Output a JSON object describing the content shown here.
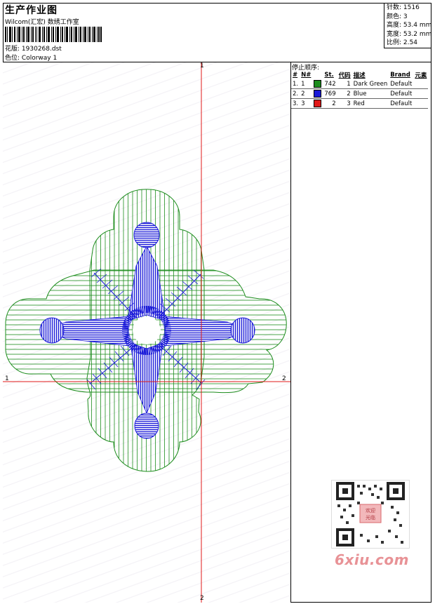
{
  "header": {
    "title": "生产作业图",
    "studio": "Wilcom(汇宏) 数绣工作室",
    "file_label": "花版:",
    "file_value": "1930268.dst",
    "colorway_label": "色位:",
    "colorway_value": "Colorway 1"
  },
  "specs": {
    "stitches_label": "针数:",
    "stitches_value": "1516",
    "colors_label": "颜色:",
    "colors_value": "3",
    "height_label": "高度:",
    "height_value": "53.4 mm",
    "width_label": "宽度:",
    "width_value": "53.2 mm",
    "ratio_label": "比例:",
    "ratio_value": "2.54"
  },
  "stop_sequence": {
    "title": "停止顺序:",
    "columns": [
      "#",
      "N#",
      "St.",
      "代码",
      "描述",
      "Brand",
      "元素"
    ],
    "rows": [
      {
        "idx": "1.",
        "needle": "1",
        "color": "#1c8c1c",
        "stitches": "742",
        "code": "1",
        "desc": "Dark Green",
        "brand": "Default"
      },
      {
        "idx": "2.",
        "needle": "2",
        "color": "#1a1ad8",
        "stitches": "769",
        "code": "2",
        "desc": "Blue",
        "brand": "Default"
      },
      {
        "idx": "3.",
        "needle": "3",
        "color": "#e01818",
        "stitches": "2",
        "code": "3",
        "desc": "Red",
        "brand": "Default"
      }
    ]
  },
  "axes": {
    "top": "1",
    "bottom": "2",
    "left": "1",
    "right": "2"
  },
  "colors": {
    "green": "#1c8c1c",
    "blue": "#1a1ad8",
    "red": "#e01818"
  },
  "watermark": "6xiu.com",
  "qr_badge": "欢迎光临"
}
